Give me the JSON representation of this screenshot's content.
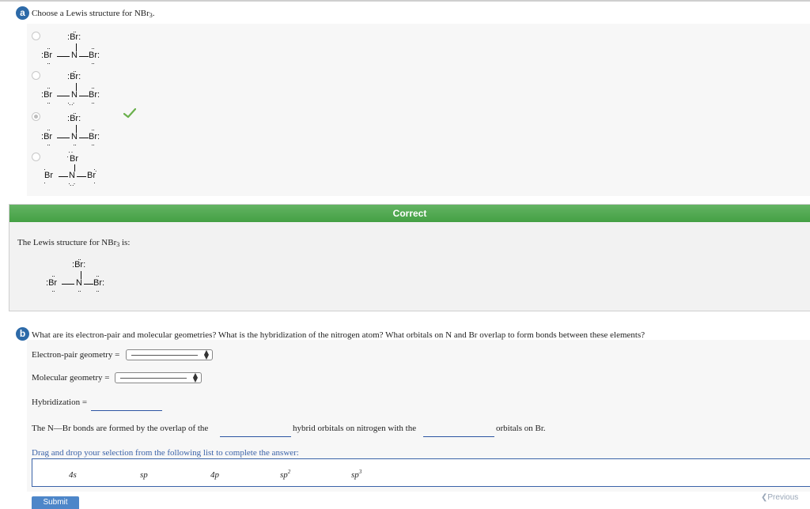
{
  "part_a": {
    "badge": "a",
    "question_prefix": "Choose a Lewis structure for NBr",
    "question_sub": "3",
    "question_suffix": ".",
    "options": [
      {
        "atoms": {
          "top": "Br",
          "left": "Br",
          "center": "N",
          "right": "Br"
        }
      },
      {
        "atoms": {
          "top": "Br",
          "left": "Br",
          "center": "N",
          "right": "Br"
        }
      },
      {
        "atoms": {
          "top": "Br",
          "left": "Br",
          "center": "N",
          "right": "Br"
        },
        "selected": true
      },
      {
        "atoms": {
          "top": "Br",
          "left": "Br",
          "center": "N",
          "right": "Br"
        }
      }
    ],
    "check_color": "#6ab04c"
  },
  "correct": {
    "banner": "Correct",
    "text_prefix": "The Lewis structure for NBr",
    "text_sub": "3",
    "text_suffix": " is:",
    "atoms": {
      "top": "Br",
      "left": "Br",
      "center": "N",
      "right": "Br"
    }
  },
  "part_b": {
    "badge": "b",
    "question": "What are its electron-pair and molecular geometries? What is the hybridization of the nitrogen atom? What orbitals on N and Br overlap to form bonds between these elements?",
    "electron_pair_label": "Electron-pair geometry =",
    "molecular_label": "Molecular geometry =",
    "hybridization_label": "Hybridization =",
    "bond_text_1": "The N—Br bonds are formed by the overlap of the",
    "bond_text_2": "hybrid orbitals on nitrogen with the",
    "bond_text_3": "orbitals on Br.",
    "drag_instruction": "Drag and drop your selection from the following list to complete the answer:",
    "choices": [
      {
        "base": "4s",
        "sup": ""
      },
      {
        "base": "sp",
        "sup": ""
      },
      {
        "base": "4p",
        "sup": ""
      },
      {
        "base": "sp",
        "sup": "2"
      },
      {
        "base": "sp",
        "sup": "3"
      }
    ]
  },
  "footer": {
    "submit_label": "Submit",
    "previous_label": "Previous"
  },
  "colors": {
    "badge": "#2d6aa8",
    "correct_banner": "#4fa64f",
    "link_blue": "#3b63a8"
  }
}
